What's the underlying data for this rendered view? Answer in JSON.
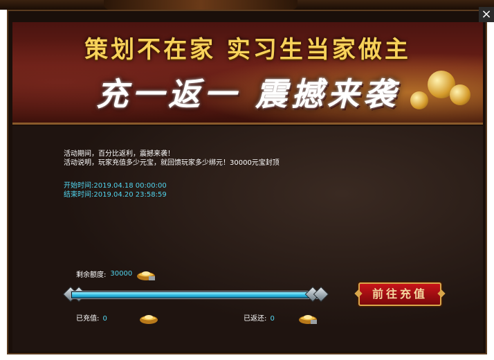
{
  "window": {
    "close_label": "×"
  },
  "banner": {
    "line1": "策划不在家  实习生当家做主",
    "line2": "充一返一  震撼来袭"
  },
  "info": {
    "line1": "活动期间，百分比返利，震撼来袭！",
    "line2": "活动说明，玩家充值多少元宝，就回馈玩家多少绑元！30000元宝封顶"
  },
  "times": {
    "start": "开始时间:2019.04.18 00:00:00",
    "end": "结束时间:2019.04.20 23:58:59"
  },
  "remaining": {
    "label": "剩余额度:",
    "value": "30000"
  },
  "progress": {
    "fraction": 1.0
  },
  "charged": {
    "label": "已充值:",
    "value": "0"
  },
  "returned": {
    "label": "已返还:",
    "value": "0"
  },
  "recharge_button": {
    "label": "前往充值"
  },
  "colors": {
    "accent_cyan": "#52d6f0",
    "button_red": "#c8141a",
    "gold": "#f7d25a"
  },
  "icons": [
    "close-icon",
    "gold-ingot-icon",
    "diamond-end-icon"
  ]
}
